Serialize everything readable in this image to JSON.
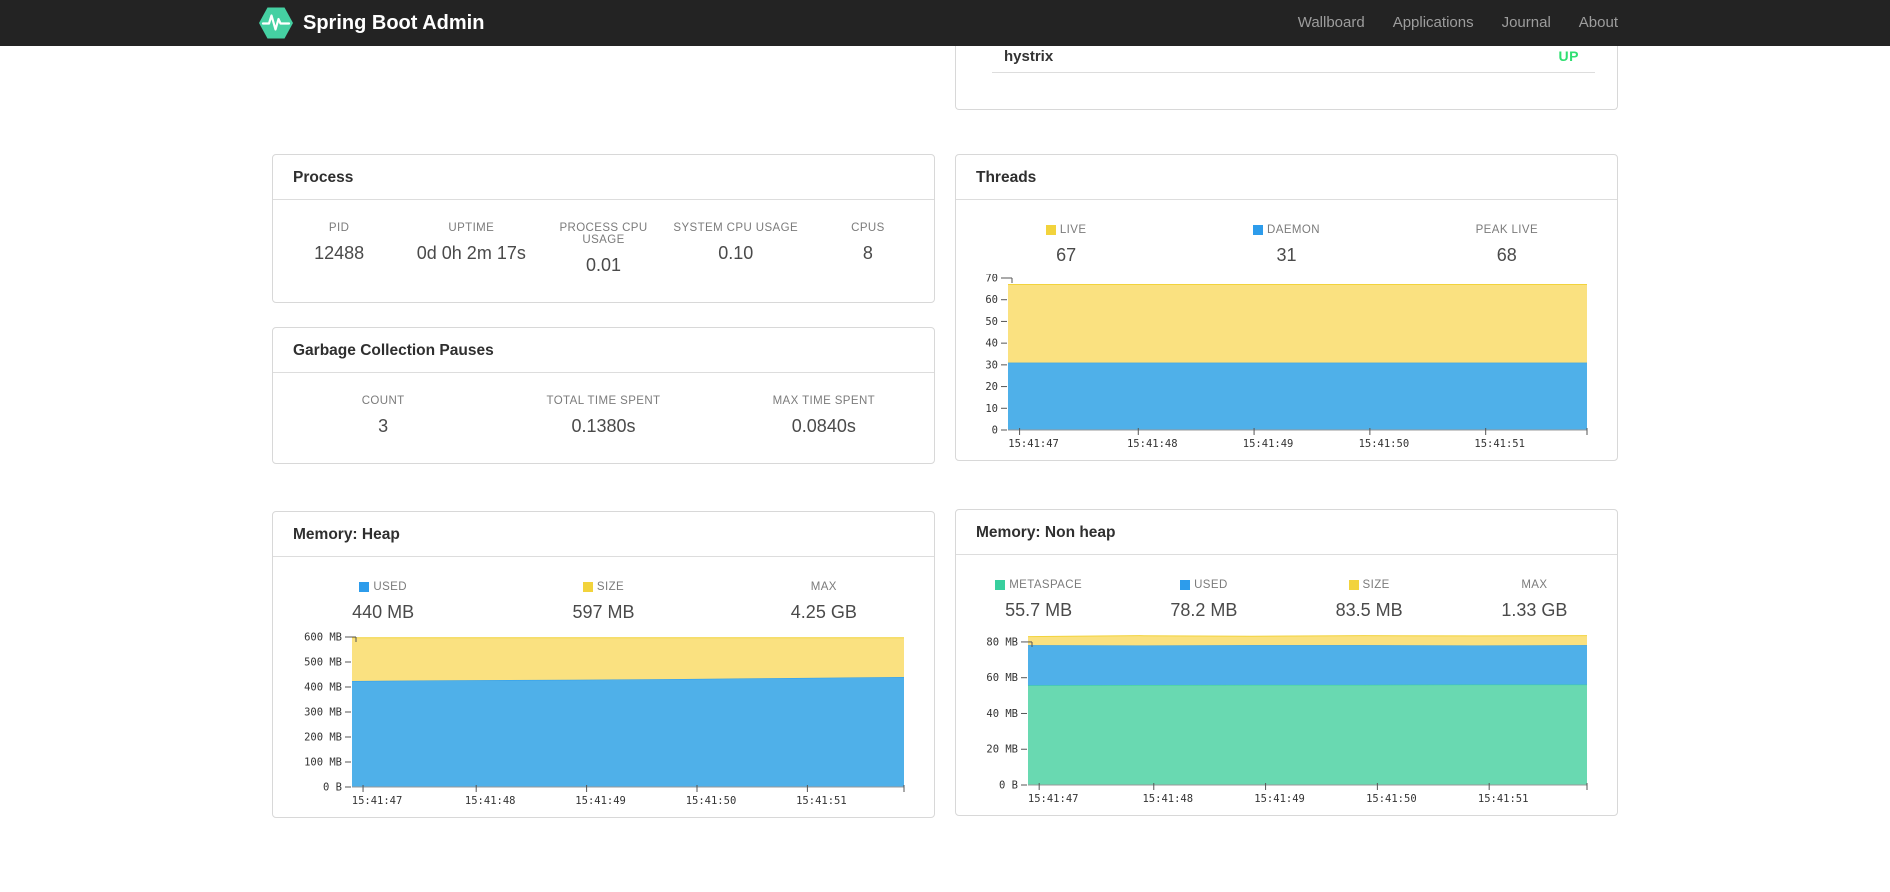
{
  "navbar": {
    "brand": "Spring Boot Admin",
    "brand_color": "#45d0a2",
    "links": [
      {
        "label": "Wallboard"
      },
      {
        "label": "Applications"
      },
      {
        "label": "Journal"
      },
      {
        "label": "About"
      }
    ]
  },
  "status_card": {
    "application": "hystrix",
    "status": "UP",
    "status_color": "#2fdf71"
  },
  "cards": {
    "process": {
      "title": "Process",
      "metrics": [
        {
          "label": "PID",
          "value": "12488"
        },
        {
          "label": "UPTIME",
          "value": "0d 0h 2m 17s"
        },
        {
          "label": "PROCESS CPU USAGE",
          "value": "0.01"
        },
        {
          "label": "SYSTEM CPU USAGE",
          "value": "0.10"
        },
        {
          "label": "CPUS",
          "value": "8"
        }
      ]
    },
    "gc": {
      "title": "Garbage Collection Pauses",
      "metrics": [
        {
          "label": "COUNT",
          "value": "3"
        },
        {
          "label": "TOTAL TIME SPENT",
          "value": "0.1380s"
        },
        {
          "label": "MAX TIME SPENT",
          "value": "0.0840s"
        }
      ]
    },
    "threads": {
      "title": "Threads",
      "metrics": [
        {
          "label": "LIVE",
          "value": "67",
          "swatch": "#f2d33c"
        },
        {
          "label": "DAEMON",
          "value": "31",
          "swatch": "#2d9ceb"
        },
        {
          "label": "PEAK LIVE",
          "value": "68"
        }
      ]
    },
    "heap": {
      "title": "Memory: Heap",
      "metrics": [
        {
          "label": "USED",
          "value": "440 MB",
          "swatch": "#2d9ceb"
        },
        {
          "label": "SIZE",
          "value": "597 MB",
          "swatch": "#f2d33c"
        },
        {
          "label": "MAX",
          "value": "4.25 GB"
        }
      ]
    },
    "nonheap": {
      "title": "Memory: Non heap",
      "metrics": [
        {
          "label": "METASPACE",
          "value": "55.7 MB",
          "swatch": "#38cf9e"
        },
        {
          "label": "USED",
          "value": "78.2 MB",
          "swatch": "#2d9ceb"
        },
        {
          "label": "SIZE",
          "value": "83.5 MB",
          "swatch": "#f2d33c"
        },
        {
          "label": "MAX",
          "value": "1.33 GB"
        }
      ]
    }
  },
  "chart_data": [
    {
      "type": "area",
      "stacked": true,
      "title": "Threads",
      "legend_position": "top",
      "grid": false,
      "x_labels": [
        "15:41:47",
        "15:41:48",
        "15:41:49",
        "15:41:50",
        "15:41:51"
      ],
      "ylim": [
        0,
        70
      ],
      "yticks": [
        {
          "v": 0,
          "label": "0"
        },
        {
          "v": 10,
          "label": "10"
        },
        {
          "v": 20,
          "label": "20"
        },
        {
          "v": 30,
          "label": "30"
        },
        {
          "v": 40,
          "label": "40"
        },
        {
          "v": 50,
          "label": "50"
        },
        {
          "v": 60,
          "label": "60"
        },
        {
          "v": 70,
          "label": "70"
        }
      ],
      "series": [
        {
          "name": "DAEMON",
          "color": "#2d9ceb",
          "fill": "#4fb0e9",
          "values": [
            31,
            31,
            31,
            31,
            31,
            31
          ]
        },
        {
          "name": "LIVE",
          "color": "#f2d33c",
          "fill": "#fae180",
          "values": [
            67,
            67,
            67,
            67,
            67,
            67
          ]
        }
      ]
    },
    {
      "type": "area",
      "stacked": true,
      "title": "Memory: Heap (MB)",
      "legend_position": "top",
      "grid": false,
      "x_labels": [
        "15:41:47",
        "15:41:48",
        "15:41:49",
        "15:41:50",
        "15:41:51"
      ],
      "ylim": [
        0,
        608
      ],
      "yticks": [
        {
          "v": 0,
          "label": "0 B"
        },
        {
          "v": 100,
          "label": "100 MB"
        },
        {
          "v": 200,
          "label": "200 MB"
        },
        {
          "v": 300,
          "label": "300 MB"
        },
        {
          "v": 400,
          "label": "400 MB"
        },
        {
          "v": 500,
          "label": "500 MB"
        },
        {
          "v": 600,
          "label": "600 MB"
        }
      ],
      "series": [
        {
          "name": "USED",
          "color": "#2d9ceb",
          "fill": "#4fb0e9",
          "values": [
            424,
            427,
            429,
            432,
            436,
            440
          ]
        },
        {
          "name": "SIZE",
          "color": "#f2d33c",
          "fill": "#fae180",
          "values": [
            597,
            597,
            597,
            597,
            597,
            597
          ]
        }
      ]
    },
    {
      "type": "area",
      "stacked": true,
      "title": "Memory: Non heap (MB)",
      "legend_position": "top",
      "grid": false,
      "x_labels": [
        "15:41:47",
        "15:41:48",
        "15:41:49",
        "15:41:50",
        "15:41:51"
      ],
      "ylim": [
        0,
        85
      ],
      "yticks": [
        {
          "v": 0,
          "label": "0 B"
        },
        {
          "v": 20,
          "label": "20 MB"
        },
        {
          "v": 40,
          "label": "40 MB"
        },
        {
          "v": 60,
          "label": "60 MB"
        },
        {
          "v": 80,
          "label": "80 MB"
        }
      ],
      "series": [
        {
          "name": "METASPACE",
          "color": "#38cf9e",
          "fill": "#69d9b1",
          "values": [
            55.7,
            55.9,
            56.0,
            56.0,
            56.1,
            56.1
          ]
        },
        {
          "name": "USED",
          "color": "#2d9ceb",
          "fill": "#4fb0e9",
          "values": [
            78.2,
            78.0,
            78.2,
            78.2,
            78.0,
            78.2
          ]
        },
        {
          "name": "SIZE",
          "color": "#f2d33c",
          "fill": "#fae180",
          "values": [
            83.0,
            83.5,
            83.2,
            83.5,
            83.4,
            83.5
          ]
        }
      ]
    }
  ]
}
